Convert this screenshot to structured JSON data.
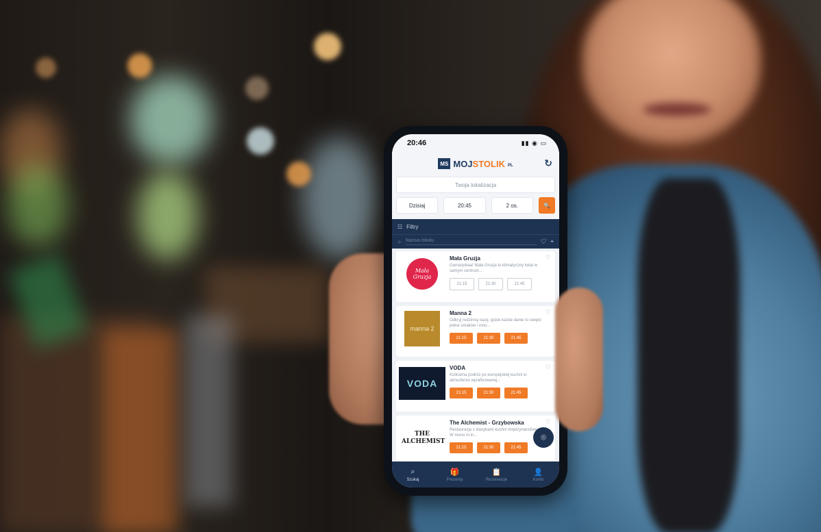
{
  "status_bar": {
    "time": "20:46",
    "icons": "▮▮ ◉ ▭"
  },
  "app": {
    "logo_mark": "MS",
    "logo_main": "MOJ",
    "logo_accent": "STOLIK",
    "logo_suffix": "PL",
    "refresh_icon": "↻"
  },
  "search": {
    "location_placeholder": "Twoja lokalizacja",
    "date": "Dzisiaj",
    "time": "20:45",
    "people": "2 os.",
    "search_icon": "🔍"
  },
  "filters": {
    "label": "Filtry",
    "icon": "☷"
  },
  "name_search": {
    "placeholder": "Nazwa lokalu",
    "icon": "⌕"
  },
  "restaurants": [
    {
      "name": "Mała Gruzja",
      "logo_text": "Mała Gruzja",
      "description": "Gamarjobaa! Mała Gruzja to klimatyczny lokal w samym centrum...",
      "times": [
        "21:15",
        "21:30",
        "21:45"
      ],
      "times_available": false
    },
    {
      "name": "Manna 2",
      "logo_text": "manna 2",
      "description": "Odkryj rodzinną oazę, gdzie każde danie to święto pełne smaków i inno...",
      "times": [
        "21:15",
        "21:30",
        "21:45"
      ],
      "times_available": true
    },
    {
      "name": "VODA",
      "logo_text": "VODA",
      "description": "Kulinarna podróż po europejskiej kuchni w atmosferze wyrafinowanej...",
      "times": [
        "21:15",
        "21:30",
        "21:45"
      ],
      "times_available": true
    },
    {
      "name": "The Alchemist - Grzybowska",
      "logo_text": "THE ALCHEMIST",
      "description": "Restauracja z klasykami kuchni międzynarodowej. W menu m.in...",
      "times": [
        "21:15",
        "21:30",
        "21:45"
      ],
      "times_available": true
    }
  ],
  "tabs": [
    {
      "label": "Szukaj",
      "icon": "⌕",
      "active": true
    },
    {
      "label": "Prezenty",
      "icon": "🎁",
      "active": false
    },
    {
      "label": "Rezerwacje",
      "icon": "📋",
      "active": false
    },
    {
      "label": "Konto",
      "icon": "👤",
      "active": false
    }
  ],
  "colors": {
    "navy": "#1e3352",
    "orange": "#f07a26",
    "light": "#f3f5f8"
  }
}
